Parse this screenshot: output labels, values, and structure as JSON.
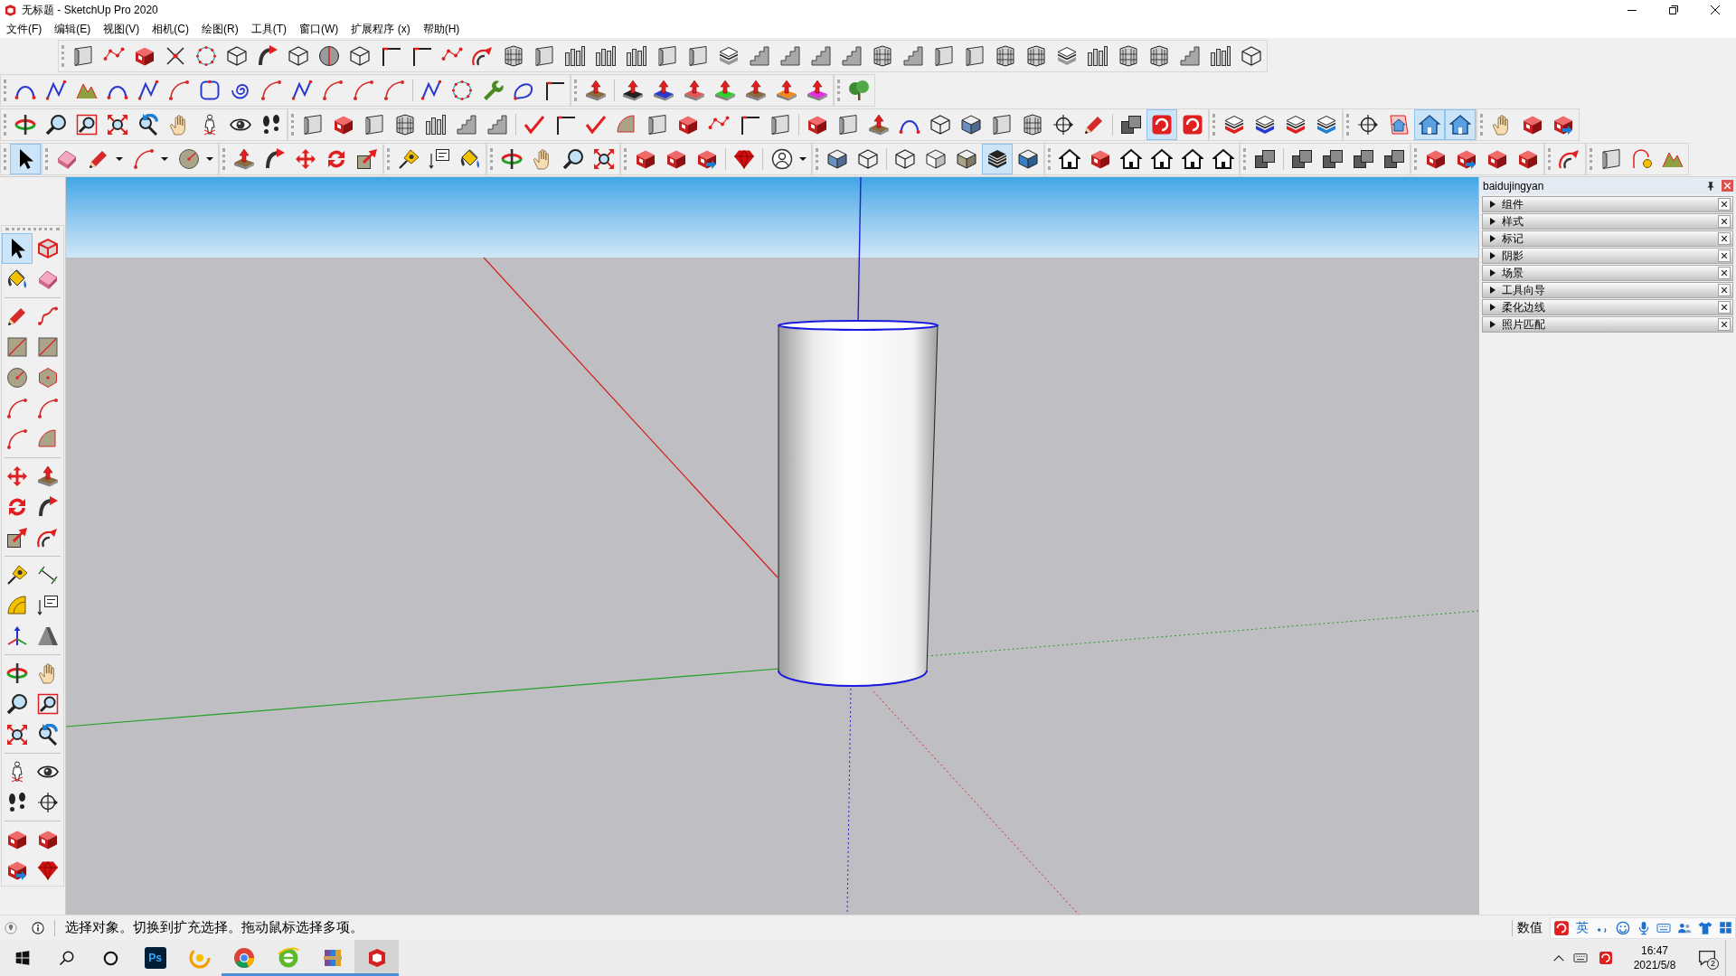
{
  "window": {
    "title": "无标题 - SketchUp Pro 2020"
  },
  "menu_bar": [
    "文件(F)",
    "编辑(E)",
    "视图(V)",
    "相机(C)",
    "绘图(R)",
    "工具(T)",
    "窗口(W)",
    "扩展程序 (x)",
    "帮助(H)"
  ],
  "toolbars": [
    {
      "buttons": [
        {
          "selected": false
        },
        {
          "selected": false
        },
        {
          "selected": false
        },
        {
          "selected": false
        },
        {
          "selected": false
        },
        {
          "selected": false
        },
        {
          "selected": false
        },
        {
          "selected": false
        },
        {
          "selected": false
        },
        {
          "selected": false
        },
        {
          "selected": false
        },
        {
          "selected": false
        },
        {
          "selected": false
        },
        {
          "selected": false
        },
        {
          "selected": false
        },
        {
          "selected": false
        },
        {
          "selected": false
        },
        {
          "selected": false
        },
        {
          "selected": false
        },
        {
          "selected": false
        },
        {
          "selected": false
        },
        {
          "selected": false
        },
        {
          "selected": false
        },
        {
          "selected": false
        },
        {
          "selected": false
        },
        {
          "selected": false
        },
        {
          "selected": false
        },
        {
          "selected": false
        },
        {
          "selected": false
        },
        {
          "selected": false
        },
        {
          "selected": false
        },
        {
          "selected": false
        },
        {
          "selected": false
        },
        {
          "selected": false
        },
        {
          "selected": false
        },
        {
          "selected": false
        },
        {
          "selected": false
        },
        {
          "selected": false
        },
        {
          "selected": false
        }
      ]
    },
    {
      "buttons": [
        {
          "selected": false
        },
        {
          "selected": false
        },
        {
          "selected": false
        },
        {
          "selected": false
        },
        {
          "selected": false
        },
        {
          "selected": false
        },
        {
          "selected": false
        },
        {
          "selected": false
        },
        {
          "selected": false
        },
        {
          "selected": false
        },
        {
          "selected": false
        },
        {
          "selected": false
        },
        {
          "selected": false
        },
        {
          "selected": false
        },
        {
          "selected": false
        },
        {
          "selected": false
        },
        {
          "selected": false
        },
        {
          "selected": false
        }
      ]
    },
    {
      "buttons": [
        {
          "selected": false
        },
        {
          "selected": false
        },
        {
          "selected": false
        },
        {
          "selected": false
        },
        {
          "selected": false
        },
        {
          "selected": false
        },
        {
          "selected": false
        },
        {
          "selected": false
        }
      ]
    },
    {
      "buttons": [
        {
          "selected": false
        }
      ]
    },
    {
      "buttons": [
        {
          "selected": false
        },
        {
          "selected": false
        },
        {
          "selected": false
        },
        {
          "selected": false
        },
        {
          "selected": false
        },
        {
          "selected": false
        },
        {
          "selected": false
        },
        {
          "selected": false
        },
        {
          "selected": false
        }
      ]
    },
    {
      "buttons": [
        {
          "selected": false
        },
        {
          "selected": false
        },
        {
          "selected": false
        },
        {
          "selected": false
        },
        {
          "selected": false
        },
        {
          "selected": false
        },
        {
          "selected": false
        },
        {
          "selected": false
        },
        {
          "selected": false
        },
        {
          "selected": false
        },
        {
          "selected": false
        },
        {
          "selected": false
        },
        {
          "selected": false
        },
        {
          "selected": false
        },
        {
          "selected": false
        },
        {
          "selected": false
        },
        {
          "selected": false
        },
        {
          "selected": false
        },
        {
          "selected": false
        },
        {
          "selected": false
        },
        {
          "selected": false
        },
        {
          "selected": false
        },
        {
          "selected": false
        },
        {
          "selected": false
        },
        {
          "selected": false
        },
        {
          "selected": false
        },
        {
          "selected": false
        },
        {
          "selected": true
        },
        {
          "selected": false
        }
      ]
    },
    {
      "buttons": [
        {
          "selected": false
        },
        {
          "selected": false
        },
        {
          "selected": false
        },
        {
          "selected": false
        }
      ]
    },
    {
      "buttons": [
        {
          "selected": false
        },
        {
          "selected": false
        },
        {
          "selected": true
        },
        {
          "selected": true
        }
      ]
    },
    {
      "buttons": [
        {
          "selected": false
        },
        {
          "selected": false
        },
        {
          "selected": false
        }
      ]
    },
    {
      "buttons": [
        {
          "selected": true
        }
      ]
    },
    {
      "buttons": [
        {
          "selected": false
        },
        {
          "selected": false
        },
        {
          "selected": false
        },
        {
          "selected": false
        }
      ]
    },
    {
      "buttons": [
        {
          "selected": false
        },
        {
          "selected": false
        },
        {
          "selected": false
        },
        {
          "selected": false
        },
        {
          "selected": false
        }
      ]
    },
    {
      "buttons": [
        {
          "selected": false
        },
        {
          "selected": false
        },
        {
          "selected": false
        }
      ]
    },
    {
      "buttons": [
        {
          "selected": false
        },
        {
          "selected": false
        },
        {
          "selected": false
        },
        {
          "selected": false
        }
      ]
    },
    {
      "buttons": [
        {
          "selected": false
        },
        {
          "selected": false
        },
        {
          "selected": false
        },
        {
          "selected": false
        },
        {
          "selected": false
        }
      ]
    },
    {
      "buttons": [
        {
          "selected": false
        },
        {
          "selected": false
        },
        {
          "selected": false
        },
        {
          "selected": false
        },
        {
          "selected": false
        },
        {
          "selected": true
        },
        {
          "selected": false
        }
      ]
    },
    {
      "buttons": [
        {
          "selected": false
        },
        {
          "selected": false
        },
        {
          "selected": false
        },
        {
          "selected": false
        },
        {
          "selected": false
        },
        {
          "selected": false
        }
      ]
    },
    {
      "buttons": [
        {
          "selected": false
        },
        {
          "selected": false
        },
        {
          "selected": false
        },
        {
          "selected": false
        },
        {
          "selected": false
        }
      ]
    },
    {
      "buttons": [
        {
          "selected": false
        },
        {
          "selected": false
        },
        {
          "selected": false
        },
        {
          "selected": false
        }
      ]
    },
    {
      "buttons": [
        {
          "selected": false
        }
      ]
    },
    {
      "buttons": [
        {
          "selected": false
        },
        {
          "selected": false
        },
        {
          "selected": false
        }
      ]
    },
    {
      "buttons": [
        {
          "selected": true
        },
        {
          "selected": false
        },
        {
          "selected": false
        },
        {
          "selected": false
        },
        {
          "selected": false
        },
        {
          "selected": false
        },
        {
          "selected": false
        },
        {
          "selected": false
        },
        {
          "selected": false
        },
        {
          "selected": false
        },
        {
          "selected": false
        },
        {
          "selected": false
        },
        {
          "selected": false
        },
        {
          "selected": false
        },
        {
          "selected": false
        },
        {
          "selected": false
        },
        {
          "selected": false
        },
        {
          "selected": false
        },
        {
          "selected": false
        },
        {
          "selected": false
        },
        {
          "selected": false
        },
        {
          "selected": false
        },
        {
          "selected": false
        },
        {
          "selected": false
        },
        {
          "selected": false
        },
        {
          "selected": false
        },
        {
          "selected": false
        },
        {
          "selected": false
        },
        {
          "selected": false
        },
        {
          "selected": false
        },
        {
          "selected": false
        },
        {
          "selected": false
        },
        {
          "selected": false
        },
        {
          "selected": false
        },
        {
          "selected": false
        },
        {
          "selected": false
        },
        {
          "selected": false
        },
        {
          "selected": false
        },
        {
          "selected": false
        },
        {
          "selected": false
        }
      ]
    }
  ],
  "tray": {
    "title": "baidujingyan",
    "sections": [
      {
        "label": "组件",
        "expanded": false
      },
      {
        "label": "样式",
        "expanded": false
      },
      {
        "label": "标记",
        "expanded": false
      },
      {
        "label": "阴影",
        "expanded": false
      },
      {
        "label": "场景",
        "expanded": false
      },
      {
        "label": "工具向导",
        "expanded": false
      },
      {
        "label": "柔化边线",
        "expanded": false
      },
      {
        "label": "照片匹配",
        "expanded": false
      }
    ]
  },
  "status_bar": {
    "message": "选择对象。切换到扩充选择。拖动鼠标选择多项。",
    "measurements_label": "数值",
    "ime_mode": "英"
  },
  "taskbar": {
    "apps": [
      {
        "kind": "photo-editor",
        "text": "Ps",
        "running": false,
        "selected": false
      },
      {
        "kind": "swirl",
        "running": false,
        "selected": false
      },
      {
        "kind": "round-browser",
        "running": true,
        "selected": false
      },
      {
        "kind": "e-browser",
        "running": true,
        "selected": false
      },
      {
        "kind": "archive",
        "running": true,
        "selected": false
      },
      {
        "kind": "sketch",
        "running": true,
        "selected": true
      }
    ],
    "time": "16:47",
    "date": "2021/5/8",
    "notifications": "2"
  }
}
